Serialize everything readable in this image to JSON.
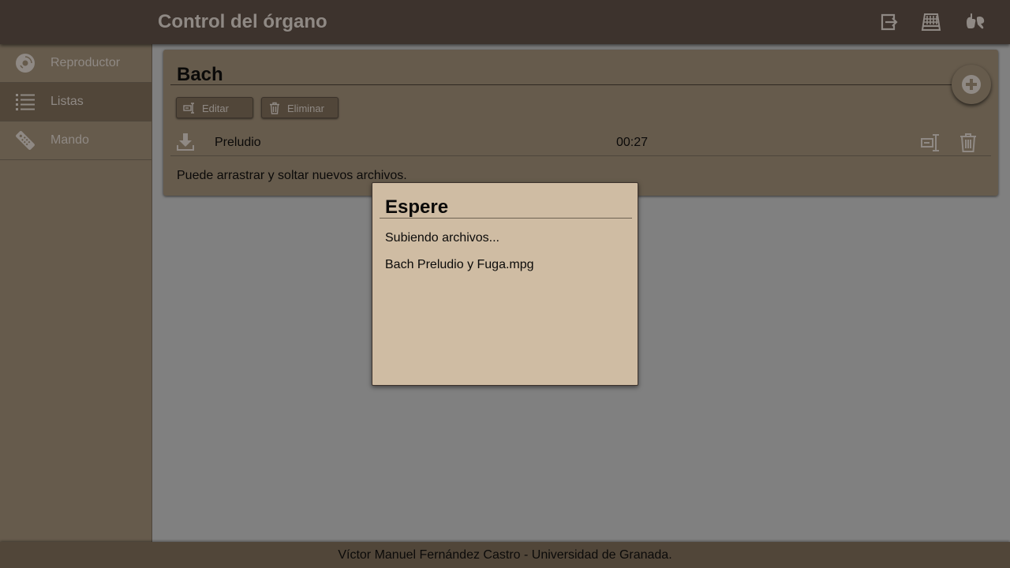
{
  "header": {
    "title": "Control del órgano",
    "icons": [
      "logout-icon",
      "keyboard-icon",
      "sign-language-icon"
    ]
  },
  "sidebar": {
    "items": [
      {
        "label": "Reproductor",
        "icon": "disc-icon",
        "active": false
      },
      {
        "label": "Listas",
        "icon": "list-icon",
        "active": true
      },
      {
        "label": "Mando",
        "icon": "remote-control-icon",
        "active": false
      }
    ]
  },
  "playlist": {
    "title": "Bach",
    "edit_label": "Editar",
    "delete_label": "Eliminar",
    "tracks": [
      {
        "name": "Preludio",
        "duration": "00:27"
      }
    ],
    "drop_hint": "Puede arrastrar y soltar nuevos archivos."
  },
  "dialog": {
    "title": "Espere",
    "message": "Subiendo archivos...",
    "file": "Bach Preludio y Fuga.mpg"
  },
  "footer": {
    "text": "Víctor Manuel Fernández Castro - Universidad de Granada."
  },
  "colors": {
    "header": "#3d332d",
    "sidebar": "#665b4c",
    "sidebar_active": "#514639",
    "dialog": "#cfbca3",
    "overlay": "#808080"
  }
}
